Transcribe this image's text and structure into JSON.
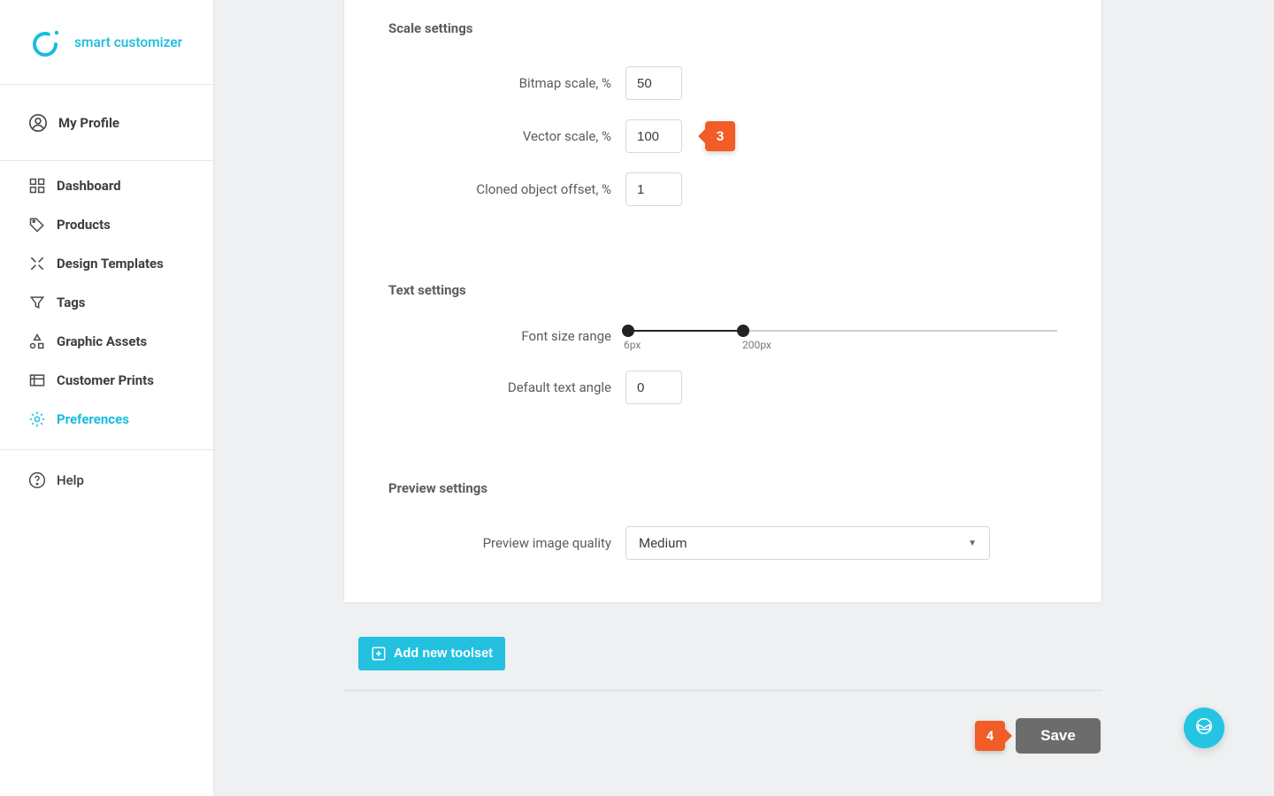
{
  "brand": {
    "name": "smart customizer"
  },
  "sidebar": {
    "profile_label": "My Profile",
    "items": [
      {
        "label": "Dashboard"
      },
      {
        "label": "Products"
      },
      {
        "label": "Design Templates"
      },
      {
        "label": "Tags"
      },
      {
        "label": "Graphic Assets"
      },
      {
        "label": "Customer Prints"
      },
      {
        "label": "Preferences"
      }
    ],
    "help_label": "Help"
  },
  "sections": {
    "scale": {
      "heading": "Scale settings",
      "bitmap_label": "Bitmap scale, %",
      "bitmap_value": "50",
      "vector_label": "Vector scale, %",
      "vector_value": "100",
      "cloned_label": "Cloned object offset, %",
      "cloned_value": "1"
    },
    "text": {
      "heading": "Text settings",
      "font_range_label": "Font size range",
      "font_range_min": "6px",
      "font_range_max": "200px",
      "angle_label": "Default text angle",
      "angle_value": "0"
    },
    "preview": {
      "heading": "Preview settings",
      "quality_label": "Preview image quality",
      "quality_value": "Medium"
    }
  },
  "buttons": {
    "add_toolset": "Add new toolset",
    "save": "Save"
  },
  "callouts": {
    "c3": "3",
    "c4": "4"
  }
}
